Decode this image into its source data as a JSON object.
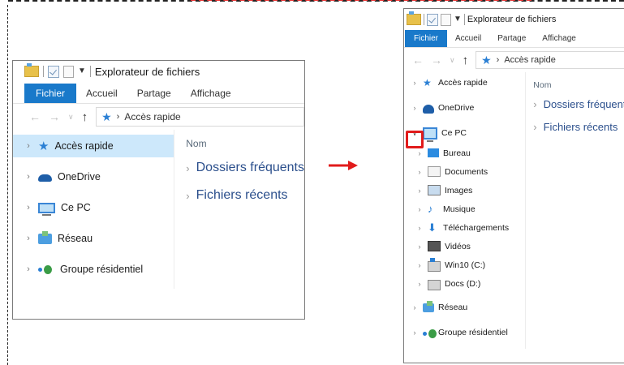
{
  "left_window": {
    "title": "Explorateur de fichiers",
    "ribbon_tabs": [
      "Fichier",
      "Accueil",
      "Partage",
      "Affichage"
    ],
    "address": "Accès rapide",
    "nav_items": [
      {
        "label": "Accès rapide",
        "icon": "star-icon",
        "selected": true
      },
      {
        "label": "OneDrive",
        "icon": "cloud-icon"
      },
      {
        "label": "Ce PC",
        "icon": "computer-icon"
      },
      {
        "label": "Réseau",
        "icon": "network-icon"
      },
      {
        "label": "Groupe résidentiel",
        "icon": "homegroup-icon"
      }
    ],
    "column_header": "Nom",
    "groups": [
      "Dossiers fréquents",
      "Fichiers récents"
    ]
  },
  "right_window": {
    "title": "Explorateur de fichiers",
    "ribbon_tabs": [
      "Fichier",
      "Accueil",
      "Partage",
      "Affichage"
    ],
    "address": "Accès rapide",
    "nav_items": [
      {
        "label": "Accès rapide",
        "icon": "star-icon"
      },
      {
        "label": "OneDrive",
        "icon": "cloud-icon"
      },
      {
        "label": "Ce PC",
        "icon": "computer-icon",
        "expanded": true
      }
    ],
    "pc_children": [
      {
        "label": "Bureau",
        "icon": "desktop-folder-icon"
      },
      {
        "label": "Documents",
        "icon": "documents-folder-icon"
      },
      {
        "label": "Images",
        "icon": "pictures-folder-icon"
      },
      {
        "label": "Musique",
        "icon": "music-folder-icon"
      },
      {
        "label": "Téléchargements",
        "icon": "downloads-folder-icon"
      },
      {
        "label": "Vidéos",
        "icon": "videos-folder-icon"
      },
      {
        "label": "Win10 (C:)",
        "icon": "system-drive-icon"
      },
      {
        "label": "Docs (D:)",
        "icon": "drive-icon"
      }
    ],
    "nav_items_after": [
      {
        "label": "Réseau",
        "icon": "network-icon"
      },
      {
        "label": "Groupe résidentiel",
        "icon": "homegroup-icon"
      }
    ],
    "column_header": "Nom",
    "groups": [
      "Dossiers fréquents",
      "Fichiers récents"
    ]
  },
  "colors": {
    "accent": "#1979ca",
    "highlight": "#e11b1b",
    "selected_bg": "#cde8fb"
  }
}
